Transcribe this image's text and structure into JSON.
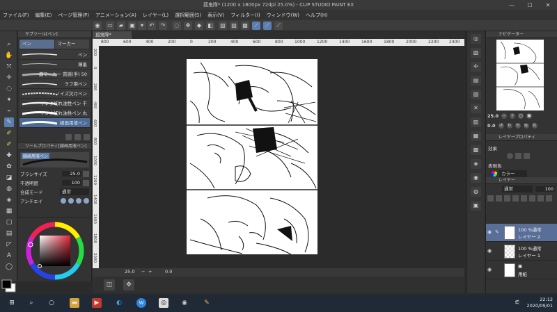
{
  "window": {
    "title": "孤鬼隊* (1200 x 1800px 72dpi 25.0%) - CLIP STUDIO PAINT EX",
    "minimize": "—",
    "maximize": "☐",
    "close": "✕"
  },
  "menu": [
    "ファイル(F)",
    "編集(E)",
    "ページ管理(P)",
    "アニメーション(A)",
    "レイヤー(L)",
    "選択範囲(S)",
    "表示(V)",
    "フィルター(I)",
    "ウィンドウ(W)",
    "ヘルプ(H)"
  ],
  "subtool": {
    "header": "サブツール[ペン]",
    "tabs": [
      "ペン",
      "マーカー"
    ],
    "brushes": [
      "ペン",
      "薄墨",
      "濃マーカー 質感(手) 50",
      "ラフ用ペン",
      "ノイズ欠けペン",
      "インク切れ油性ペン 干",
      "インク切れ油性ペン 丸",
      "線画用液ペン"
    ],
    "selected_index": 7
  },
  "toolprop": {
    "header": "ツールプロパティ[線画用液ペン]",
    "preview_label": "線画用液ペン",
    "brush_size_label": "ブラシサイズ",
    "brush_size_value": "25.0",
    "opacity_label": "不透明度",
    "opacity_value": "100",
    "blend_label": "合成モード",
    "blend_value": "通常",
    "aa_label": "アンチエイ"
  },
  "canvas": {
    "tab": "孤鬼隊*",
    "ruler_h": [
      "800",
      "600",
      "400",
      "200",
      "0",
      "200",
      "400",
      "600",
      "800",
      "1000",
      "1200",
      "1400",
      "1600",
      "1800",
      "2000",
      "2200",
      "2400"
    ],
    "ruler_v": [
      "200",
      "0",
      "200",
      "400",
      "600",
      "800",
      "1000",
      "1200",
      "1400",
      "1600",
      "1800",
      "2000"
    ],
    "zoom": "25.0",
    "angle": "0.0"
  },
  "navigator": {
    "header": "ナビゲーター",
    "zoom": "25.0",
    "angle": "0.0"
  },
  "layerprop": {
    "header": "レイヤープロパティ",
    "effect_label": "効果",
    "expression_label": "表現色",
    "expression_value": "カラー"
  },
  "layers": {
    "header": "レイヤー",
    "blend": "通常",
    "opacity": "100",
    "rows": [
      {
        "line1": "100 %通常",
        "line2": "レイヤー 2",
        "selected": true
      },
      {
        "line1": "100 %通常",
        "line2": "レイヤー 1",
        "selected": false
      },
      {
        "line1": "",
        "line2": "用紙",
        "selected": false
      }
    ]
  },
  "taskbar": {
    "time": "22:12",
    "date": "2020/09/01"
  },
  "colors": {
    "accent": "#5b7fb0",
    "selected_layer": "#5a6f98",
    "taskbar": "#1f2a36"
  }
}
